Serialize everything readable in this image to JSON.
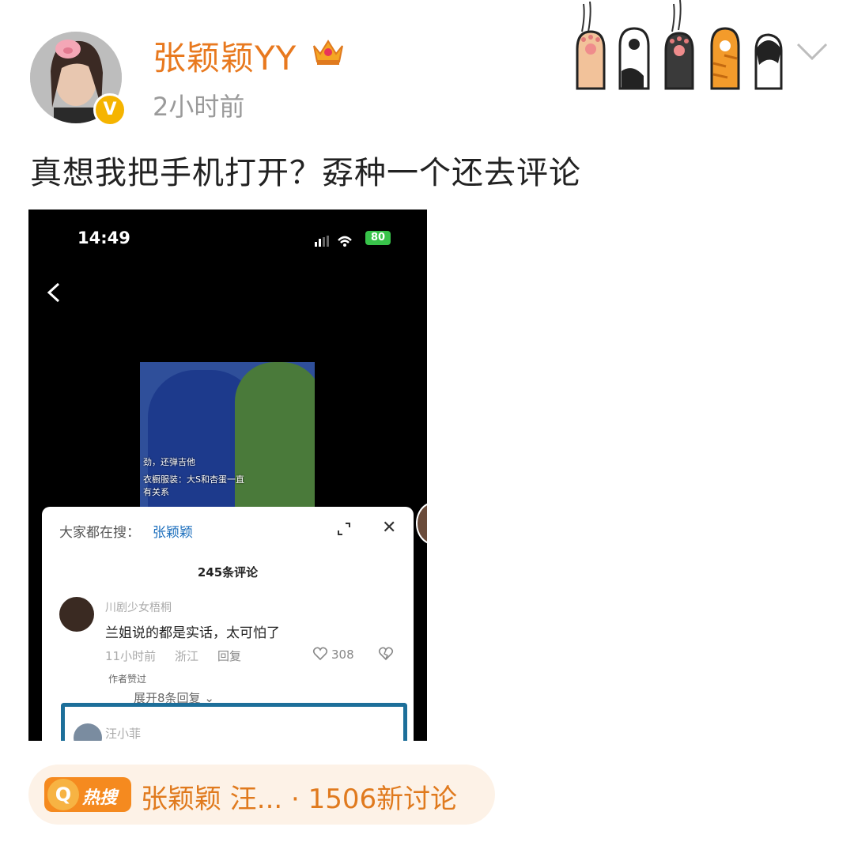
{
  "post": {
    "username": "张颖颖YY",
    "time": "2小时前",
    "text": "真想我把手机打开？孬种一个还去评论"
  },
  "phone": {
    "time": "14:49",
    "battery": "80"
  },
  "video": {
    "lines": [
      "劲，还弹吉他",
      "衣橱服装：大S和杏蛋一直",
      "有关系"
    ]
  },
  "panel": {
    "search_label": "大家都在搜：",
    "search_name": "张颖颖",
    "comment_count": "245条评论",
    "comment": {
      "user": "川剧少女梧桐",
      "text": "兰姐说的都是实话，太可怕了",
      "time": "11小时前",
      "region": "浙江",
      "reply": "回复",
      "likes": "308",
      "author_liked": "作者赞过",
      "expand": "展开8条回复"
    },
    "comment2": {
      "user": "汪小菲"
    }
  },
  "trending": {
    "badge": "热搜",
    "text": "张颖颖 汪... · 1506新讨论"
  },
  "colors": {
    "username": "#e8791f",
    "verified": "#f5b400",
    "trend_bg": "#fdf2e7",
    "trend_text": "#e07a1e"
  }
}
